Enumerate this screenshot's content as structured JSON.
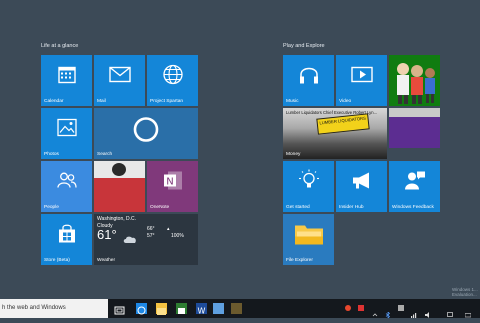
{
  "groups": {
    "left_title": "Life at a glance",
    "right_title": "Play and Explore"
  },
  "tiles": {
    "calendar": "Calendar",
    "mail": "Mail",
    "spartan": "Project Spartan",
    "photos": "Photos",
    "search": "Search",
    "people": "People",
    "onenote": "OneNote",
    "store": "Store (Beta)",
    "weather": {
      "label": "Weather",
      "city": "Washington, D.C.",
      "condition": "Cloudy",
      "temp": "61°",
      "hi": "66°",
      "lo": "57°",
      "precip": "100%"
    },
    "music": "Music",
    "video": "Video",
    "money": "Money",
    "money_headline": "Lumber Liquidators Chief Executive Robert Lyn...",
    "money_sign": "LUMBER LIQUIDATORS",
    "get_started": "Get started",
    "insider_hub": "Insider Hub",
    "windows_feedback": "Windows Feedback",
    "file_explorer": "File Explorer"
  },
  "taskbar": {
    "search_placeholder": "h the web and Windows"
  },
  "watermark": "Windows 1... Evaluation...",
  "colors": {
    "accent": "#1486d8",
    "desktop": "#3c4a57",
    "onenote": "#80397b",
    "xbox": "#107c10",
    "weather": "#2c3640",
    "taskbar": "#14181d"
  }
}
